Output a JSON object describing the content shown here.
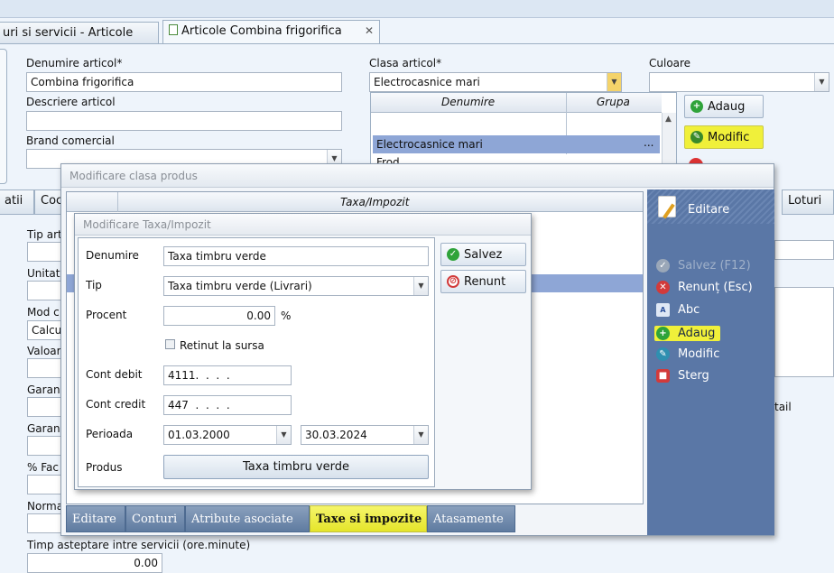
{
  "tabs": {
    "tab1_label": "uri si servicii - Articole",
    "tab2_label": "Articole Combina frigorifica",
    "tab2_close": "✕"
  },
  "form": {
    "denumire_label": "Denumire articol*",
    "denumire_value": "Combina frigorifica",
    "descriere_label": "Descriere articol",
    "descriere_value": "",
    "brand_label": "Brand comercial",
    "brand_value": "",
    "clasa_label": "Clasa articol*",
    "clasa_value": "Electrocasnice mari",
    "culoare_label": "Culoare",
    "culoare_value": "",
    "tip_label": "Tip art",
    "unitat_label": "Unitat",
    "mod_label": "Mod c",
    "mod_value": "Calcu",
    "valoar_label": "Valoar",
    "garan1_label": "Garan",
    "garan2_label": "Garan",
    "fac_label": "% Fac",
    "norma_label": "Norma",
    "timp_label": "Timp asteptare intre servicii (ore.minute)",
    "timp_value": "0.00",
    "tail_label": "tail"
  },
  "dropdown": {
    "col_denumire": "Denumire",
    "col_grupa": "Grupa",
    "selected_denumire": "Electrocasnice mari",
    "selected_grupa": "...",
    "next_row": "Frod"
  },
  "bg_buttons": {
    "adaug": "Adaug",
    "modific": "Modific"
  },
  "bg_tabs": {
    "t1": "atii",
    "t2": "Coc",
    "t3": "Loturi"
  },
  "clasa_dialog": {
    "title": "Modificare clasa produs",
    "col_taxa": "Taxa/Impozit",
    "sidebar_title": "Editare",
    "side_salvez": "Salvez (F12)",
    "side_renunt": "Renunț (Esc)",
    "side_abc": "Abc",
    "side_adaug": "Adaug",
    "side_modific": "Modific",
    "side_sterg": "Sterg",
    "bottom_tabs": [
      "Editare",
      "Conturi",
      "Atribute asociate",
      "Taxe si impozite",
      "Atasamente"
    ]
  },
  "taxa_dialog": {
    "title": "Modificare Taxa/Impozit",
    "denumire_label": "Denumire",
    "denumire_value": "Taxa timbru verde",
    "tip_label": "Tip",
    "tip_value": "Taxa timbru verde (Livrari)",
    "procent_label": "Procent",
    "procent_value": "0.00",
    "procent_unit": "%",
    "retinut_label": "Retinut la sursa",
    "cont_debit_label": "Cont debit",
    "cont_debit_value": "4111.  .  .  .",
    "cont_credit_label": "Cont credit",
    "cont_credit_value": "447  .  .  .  .",
    "perioada_label": "Perioada",
    "perioada_start": "01.03.2000",
    "perioada_end": "30.03.2024",
    "produs_label": "Produs",
    "produs_value": "Taxa timbru verde",
    "salvez": "Salvez",
    "renunt": "Renunt"
  },
  "colors": {
    "highlight": "#f2f23a",
    "sidebar_bg": "#5a77a6",
    "selection": "#8ea6d6"
  }
}
